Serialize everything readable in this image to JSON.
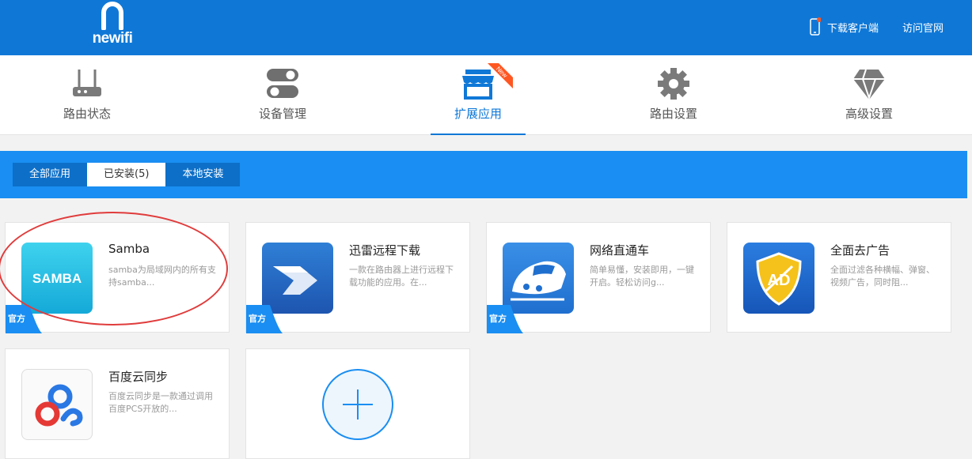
{
  "header": {
    "logo_text": "newifi",
    "download_label": "下载客户端",
    "official_label": "访问官网"
  },
  "nav": {
    "items": [
      {
        "label": "路由状态",
        "icon": "router-icon"
      },
      {
        "label": "设备管理",
        "icon": "toggles-icon"
      },
      {
        "label": "扩展应用",
        "icon": "store-icon",
        "active": true,
        "badge": "New"
      },
      {
        "label": "路由设置",
        "icon": "gear-icon"
      },
      {
        "label": "高级设置",
        "icon": "diamond-icon"
      }
    ]
  },
  "tabs": [
    {
      "label": "全部应用"
    },
    {
      "label": "已安装(5)",
      "active": true
    },
    {
      "label": "本地安装"
    }
  ],
  "apps": [
    {
      "name": "Samba",
      "desc": "samba为局域网内的所有支持samba...",
      "official": true,
      "icon_text": "SAMBA"
    },
    {
      "name": "迅雷远程下载",
      "desc": "一款在路由器上进行远程下载功能的应用。在...",
      "official": true
    },
    {
      "name": "网络直通车",
      "desc": "简单易懂，安装即用，一键开启。轻松访问g...",
      "official": true
    },
    {
      "name": "全面去广告",
      "desc": "全面过滤各种横幅、弹窗、视频广告，同时阻...",
      "official": false,
      "icon_text": "AD"
    },
    {
      "name": "百度云同步",
      "desc": "百度云同步是一款通过调用百度PCS开放的...",
      "official": false
    }
  ],
  "badge_label": "官方",
  "colors": {
    "primary": "#0f78d7",
    "tab_bar": "#1a8ef2",
    "annotation": "#e03c3c",
    "new_badge": "#ff5722"
  }
}
